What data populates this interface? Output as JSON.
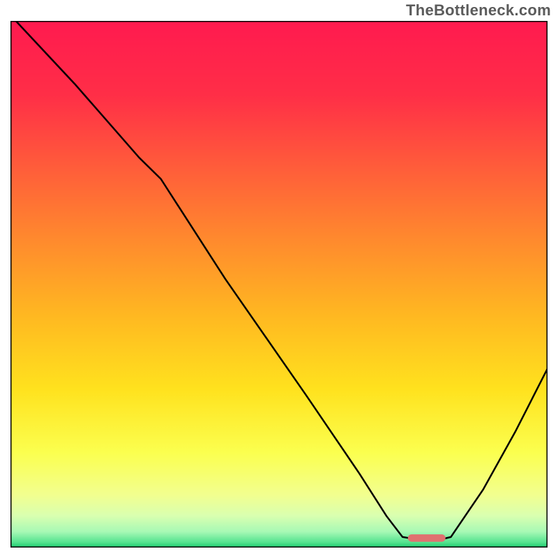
{
  "watermark": "TheBottleneck.com",
  "chart_data": {
    "type": "line",
    "xlim": [
      0,
      100
    ],
    "ylim": [
      0,
      100
    ],
    "curve": [
      {
        "x": 1,
        "y": 100
      },
      {
        "x": 12,
        "y": 88
      },
      {
        "x": 24,
        "y": 74
      },
      {
        "x": 28,
        "y": 70
      },
      {
        "x": 40,
        "y": 51
      },
      {
        "x": 55,
        "y": 29
      },
      {
        "x": 65,
        "y": 14
      },
      {
        "x": 70,
        "y": 6
      },
      {
        "x": 73,
        "y": 2
      },
      {
        "x": 76,
        "y": 1.5
      },
      {
        "x": 80,
        "y": 1.5
      },
      {
        "x": 82,
        "y": 2
      },
      {
        "x": 88,
        "y": 11
      },
      {
        "x": 94,
        "y": 22
      },
      {
        "x": 100,
        "y": 34
      }
    ],
    "marker": {
      "x_start": 74,
      "x_end": 81,
      "y": 1.8
    },
    "accent_color": "#e07170",
    "line_color": "#000000",
    "border_color": "#000000",
    "gradient_stops": [
      {
        "offset": 0,
        "color": "#ff1a4f"
      },
      {
        "offset": 14,
        "color": "#ff2e47"
      },
      {
        "offset": 28,
        "color": "#ff5d3a"
      },
      {
        "offset": 42,
        "color": "#ff8b2d"
      },
      {
        "offset": 56,
        "color": "#ffb821"
      },
      {
        "offset": 70,
        "color": "#ffe21e"
      },
      {
        "offset": 82,
        "color": "#fbff4f"
      },
      {
        "offset": 90,
        "color": "#f2ff8f"
      },
      {
        "offset": 94,
        "color": "#d9ffb0"
      },
      {
        "offset": 97,
        "color": "#a7f9b5"
      },
      {
        "offset": 99,
        "color": "#54e28f"
      },
      {
        "offset": 100,
        "color": "#18c86b"
      }
    ]
  }
}
